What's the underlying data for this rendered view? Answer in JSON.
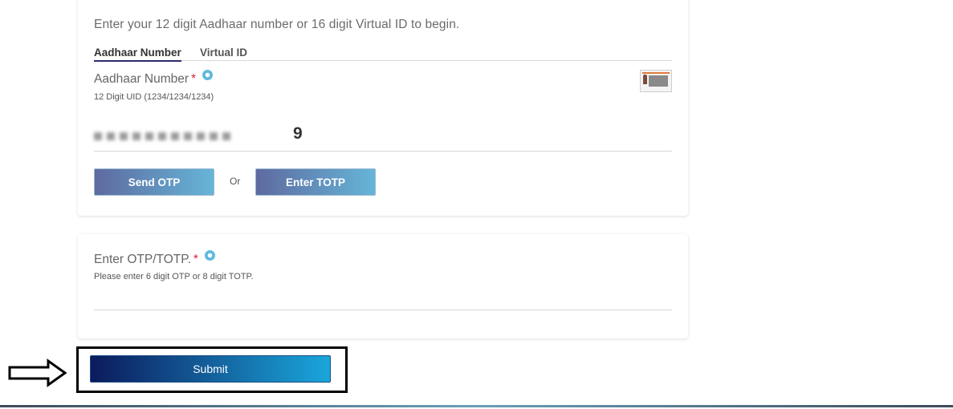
{
  "aadhaar_card": {
    "intro": "Enter your 12 digit Aadhaar number or 16 digit Virtual ID to begin.",
    "tabs": [
      {
        "label": "Aadhaar Number",
        "active": true
      },
      {
        "label": "Virtual ID",
        "active": false
      }
    ],
    "field": {
      "label": "Aadhaar Number",
      "required_mark": "*",
      "hint": "12 Digit UID (1234/1234/1234)",
      "visible_value": "9"
    },
    "buttons": {
      "send_otp": "Send OTP",
      "or": "Or",
      "enter_totp": "Enter TOTP"
    }
  },
  "otp_card": {
    "label": "Enter OTP/TOTP.",
    "required_mark": "*",
    "hint": "Please enter 6 digit OTP or 8 digit TOTP.",
    "value": ""
  },
  "submit": {
    "label": "Submit"
  },
  "icons": {
    "info": "info-icon",
    "aadhaar_card": "aadhaar-card-icon",
    "arrow": "right-arrow-icon"
  },
  "colors": {
    "accent_start": "#0c1a5c",
    "accent_end": "#1aa6db",
    "required": "#d0243f",
    "info": "#5fb9dd"
  }
}
